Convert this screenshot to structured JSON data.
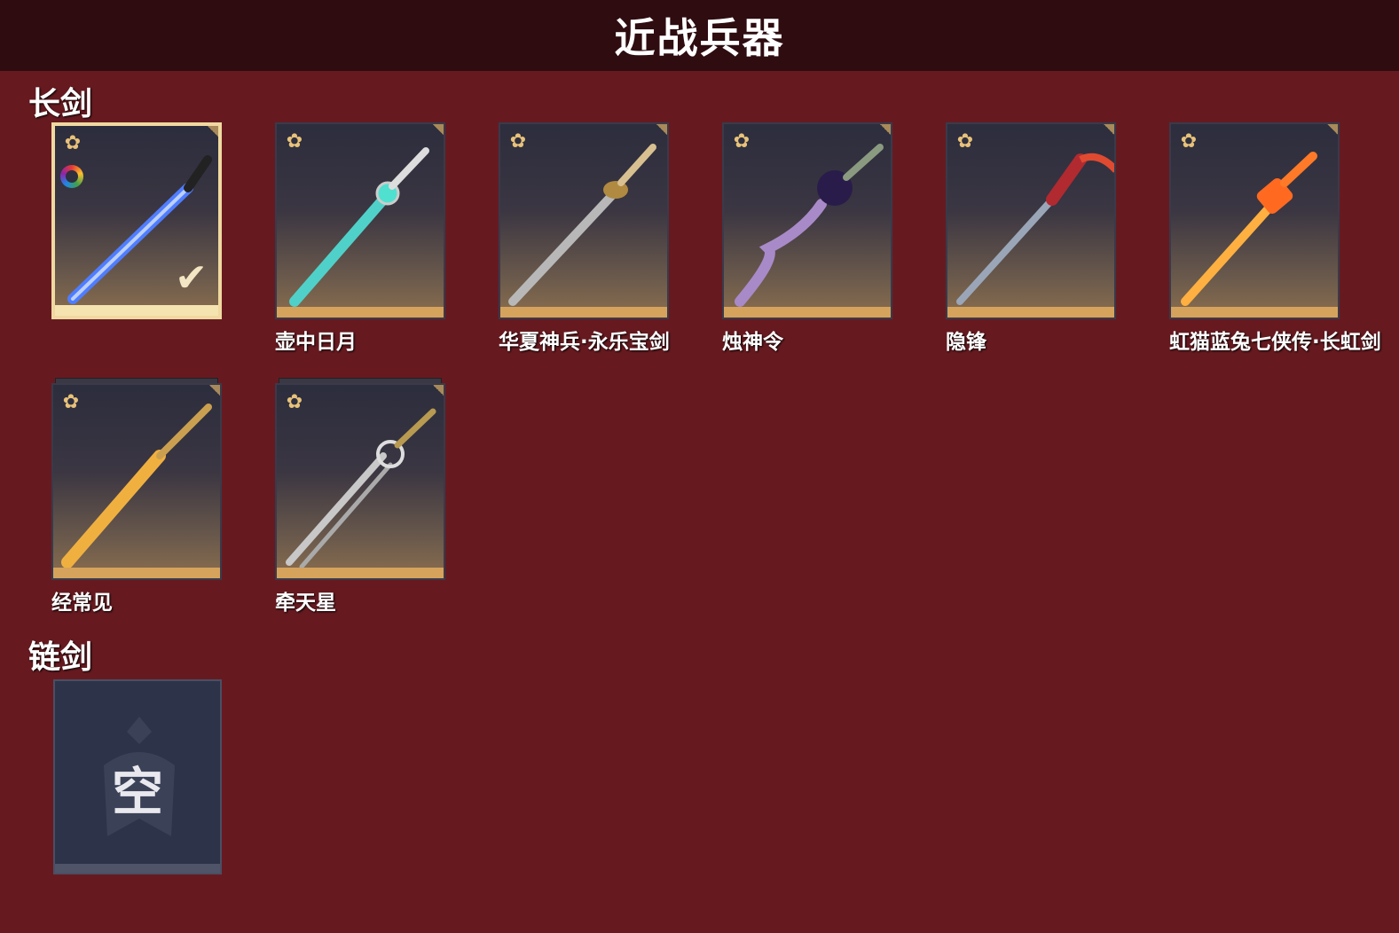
{
  "header": {
    "title": "近战兵器"
  },
  "sections": [
    {
      "label": "长剑",
      "items": [
        {
          "name": "",
          "selected": true,
          "blade_color": "#4f7dff"
        },
        {
          "name": "壶中日月",
          "blade_color": "#4fd1c9"
        },
        {
          "name": "华夏神兵·永乐宝剑",
          "blade_color": "#b8b8b8"
        },
        {
          "name": "烛神令",
          "blade_color": "#a88ac8"
        },
        {
          "name": "隐锋",
          "blade_color": "#9aa6b8"
        },
        {
          "name": "虹猫蓝兔七侠传·长虹剑",
          "blade_color": "#ff8a30"
        },
        {
          "name": "经常见",
          "blade_color": "#f0b040"
        },
        {
          "name": "牵天星",
          "blade_color": "#c8c8c8"
        }
      ]
    },
    {
      "label": "链剑",
      "empty_label": "空"
    }
  ]
}
